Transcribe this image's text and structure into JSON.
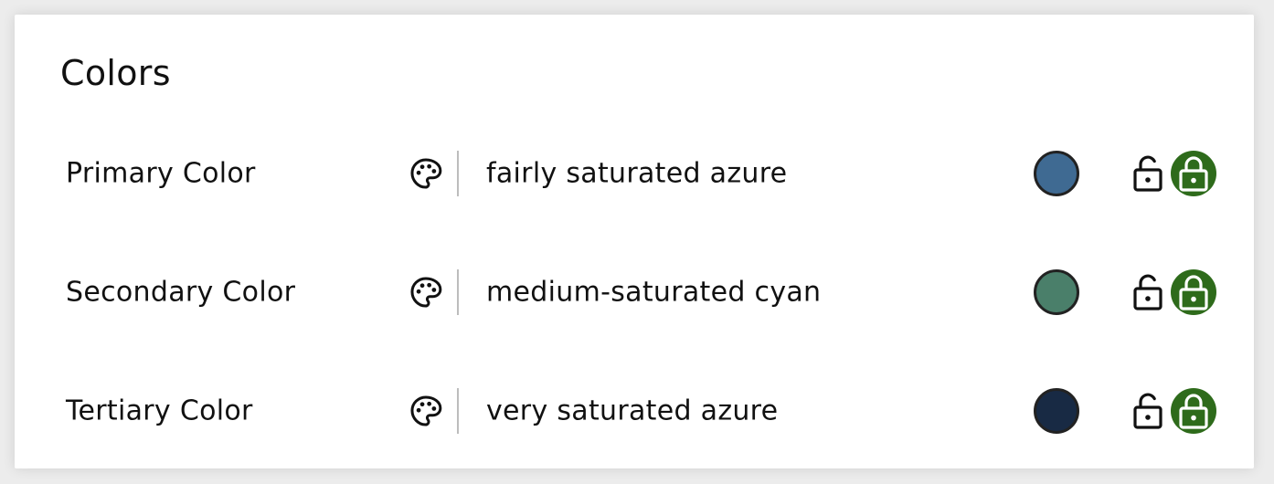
{
  "section": {
    "title": "Colors"
  },
  "rows": [
    {
      "label": "Primary Color",
      "color_name": "fairly saturated azure",
      "swatch_color": "#3f6a92",
      "icons": [
        "palette-icon",
        "unlock-icon",
        "lock-icon"
      ]
    },
    {
      "label": "Secondary Color",
      "color_name": "medium-saturated cyan",
      "swatch_color": "#4a7f6a",
      "icons": [
        "palette-icon",
        "unlock-icon",
        "lock-icon"
      ]
    },
    {
      "label": "Tertiary Color",
      "color_name": "very saturated azure",
      "swatch_color": "#182a44",
      "icons": [
        "palette-icon",
        "unlock-icon",
        "lock-icon"
      ]
    }
  ],
  "colors": {
    "lock_active_bg": "#2e6b1b",
    "swatch_border": "#222222",
    "divider": "#bdbdbd"
  }
}
